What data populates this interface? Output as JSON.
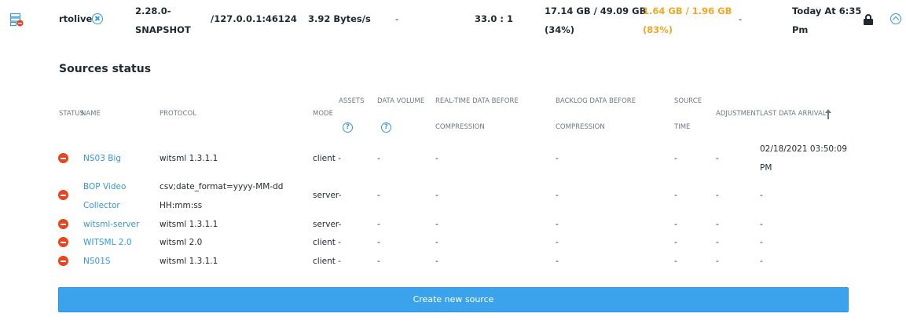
{
  "server_row": {
    "name": "rtolive",
    "version_line1": "2.28.0-",
    "version_line2": "SNAPSHOT",
    "address": "/127.0.0.1:46124",
    "rate": "3.92 Bytes/s",
    "dash1": "-",
    "ratio": "33.0 : 1",
    "disk_line1": "17.14 GB / 49.09 GB",
    "disk_line2": "(34%)",
    "memory_line1": "1.64 GB / 1.96 GB",
    "memory_line2": "(83%)",
    "dash2": "-",
    "time_line1": "Today At 6:35",
    "time_line2": "Pm",
    "warning_color": "#f5a623",
    "icons": {
      "server": "server-error-icon",
      "remove": "close-circle-icon",
      "lock": "lock-icon",
      "collapse": "chevron-up-circle-icon"
    }
  },
  "sources": {
    "title": "Sources status",
    "headers": {
      "status": "STATUS",
      "name": "NAME",
      "protocol": "PROTOCOL",
      "mode": "MODE",
      "assets": "ASSETS",
      "data_volume": "DATA VOLUME",
      "realtime_line1": "REAL-TIME DATA BEFORE",
      "realtime_line2": "COMPRESSION",
      "backlog_line1": "BACKLOG DATA BEFORE",
      "backlog_line2": "COMPRESSION",
      "source_time_line1": "SOURCE",
      "source_time_line2": "TIME",
      "adjustment": "ADJUSTMENT",
      "last_arrival": "LAST DATA ARRIVAL",
      "help_glyph": "?"
    },
    "rows": [
      {
        "name_line1": "NS03 Big",
        "name_line2": "",
        "protocol_line1": "witsml 1.3.1.1",
        "protocol_line2": "",
        "mode": "client -",
        "data_volume": "-",
        "realtime": "-",
        "backlog": "-",
        "source_time": "-",
        "adjustment": "-",
        "last_arrival_line1": "02/18/2021 03:50:09",
        "last_arrival_line2": "PM"
      },
      {
        "name_line1": "BOP Video",
        "name_line2": "Collector",
        "protocol_line1": "csv;date_format=yyyy-MM-dd",
        "protocol_line2": "HH:mm:ss",
        "mode": "server-",
        "data_volume": "-",
        "realtime": "-",
        "backlog": "-",
        "source_time": "-",
        "adjustment": "-",
        "last_arrival_line1": "-",
        "last_arrival_line2": ""
      },
      {
        "name_line1": "witsml-server",
        "name_line2": "",
        "protocol_line1": "witsml 1.3.1.1",
        "protocol_line2": "",
        "mode": "server-",
        "data_volume": "-",
        "realtime": "-",
        "backlog": "-",
        "source_time": "-",
        "adjustment": "-",
        "last_arrival_line1": "-",
        "last_arrival_line2": ""
      },
      {
        "name_line1": "WITSML 2.0",
        "name_line2": "",
        "protocol_line1": "witsml 2.0",
        "protocol_line2": "",
        "mode": "client -",
        "data_volume": "-",
        "realtime": "-",
        "backlog": "-",
        "source_time": "-",
        "adjustment": "-",
        "last_arrival_line1": "-",
        "last_arrival_line2": ""
      },
      {
        "name_line1": "NS01S",
        "name_line2": "",
        "protocol_line1": "witsml 1.3.1.1",
        "protocol_line2": "",
        "mode": "client -",
        "data_volume": "-",
        "realtime": "-",
        "backlog": "-",
        "source_time": "-",
        "adjustment": "-",
        "last_arrival_line1": "-",
        "last_arrival_line2": ""
      }
    ],
    "create_button_label": "Create new source",
    "accent_color": "#3aa3eb",
    "error_color": "#e8451f"
  }
}
